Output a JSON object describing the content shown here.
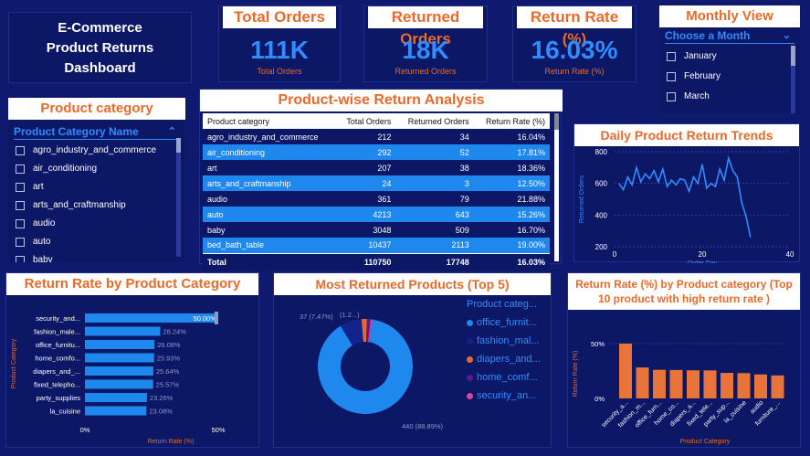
{
  "title": {
    "line1": "E-Commerce",
    "line2": "Product Returns",
    "line3": "Dashboard"
  },
  "kpis": [
    {
      "header": "Total Orders",
      "value": "111K",
      "label": "Total Orders"
    },
    {
      "header": "Returned Orders",
      "value": "18K",
      "label": "Returned Orders"
    },
    {
      "header": "Return Rate (%)",
      "value": "16.03%",
      "label": "Return Rate (%)"
    }
  ],
  "monthly_view": {
    "header": "Monthly View",
    "dropdown": "Choose a Month",
    "options": [
      "January",
      "February",
      "March"
    ]
  },
  "product_category_slicer": {
    "header": "Product category",
    "field": "Product Category Name",
    "options": [
      "agro_industry_and_commerce",
      "air_conditioning",
      "art",
      "arts_and_craftmanship",
      "audio",
      "auto",
      "baby"
    ]
  },
  "return_table": {
    "title": "Product-wise Return Analysis",
    "columns": [
      "Product category",
      "Total Orders",
      "Returned Orders",
      "Return Rate (%)"
    ],
    "rows": [
      [
        "agro_industry_and_commerce",
        "212",
        "34",
        "16.04%"
      ],
      [
        "air_conditioning",
        "292",
        "52",
        "17.81%"
      ],
      [
        "art",
        "207",
        "38",
        "18.36%"
      ],
      [
        "arts_and_craftmanship",
        "24",
        "3",
        "12.50%"
      ],
      [
        "audio",
        "361",
        "79",
        "21.88%"
      ],
      [
        "auto",
        "4213",
        "643",
        "15.26%"
      ],
      [
        "baby",
        "3048",
        "509",
        "16.70%"
      ],
      [
        "bed_bath_table",
        "10437",
        "2113",
        "19.00%"
      ]
    ],
    "total": [
      "Total",
      "110750",
      "17748",
      "16.03%"
    ]
  },
  "colors": {
    "background": "#0f1a6e",
    "tile": "#0c1766",
    "accent_blue": "#2f8dff",
    "accent_orange": "#e86a2a",
    "row_highlight": "#1e88ee"
  },
  "chart_data": [
    {
      "type": "line",
      "title": "Daily Product Return Trends",
      "xlabel": "Order Day",
      "ylabel": "Returned Orders",
      "xlim": [
        0,
        40
      ],
      "ylim": [
        200,
        800
      ],
      "xticks": [
        "0",
        "20",
        "40"
      ],
      "yticks": [
        "200",
        "400",
        "600",
        "800"
      ],
      "x": [
        1,
        2,
        3,
        4,
        5,
        6,
        7,
        8,
        9,
        10,
        11,
        12,
        13,
        14,
        15,
        16,
        17,
        18,
        19,
        20,
        21,
        22,
        23,
        24,
        25,
        26,
        27,
        28,
        29,
        30,
        31
      ],
      "y": [
        600,
        560,
        640,
        590,
        700,
        610,
        660,
        630,
        680,
        610,
        690,
        580,
        620,
        590,
        630,
        620,
        550,
        640,
        600,
        720,
        570,
        600,
        580,
        690,
        620,
        760,
        680,
        640,
        480,
        390,
        260
      ]
    },
    {
      "type": "bar",
      "orientation": "horizontal",
      "title": "Return Rate by Product Category",
      "xlabel": "Return Rate (%)",
      "ylabel": "Product Category",
      "xticks": [
        "0%",
        "50%"
      ],
      "xlim": [
        0,
        50
      ],
      "categories": [
        "security_and...",
        "fashion_male...",
        "office_furnitu...",
        "home_comfo...",
        "diapers_and_...",
        "fixed_telepho...",
        "party_supplies",
        "la_cuisine"
      ],
      "values": [
        50.0,
        28.24,
        26.08,
        25.93,
        25.64,
        25.57,
        23.26,
        23.08
      ],
      "data_labels": [
        "50.00%",
        "28.24%",
        "26.08%",
        "25.93%",
        "25.64%",
        "25.57%",
        "23.26%",
        "23.08%"
      ]
    },
    {
      "type": "pie",
      "title": "Most Returned Products (Top 5)",
      "legend_title": "Product categ...",
      "categories": [
        "office_furnit...",
        "fashion_mal...",
        "diapers_and...",
        "home_comf...",
        "security_an..."
      ],
      "values": [
        440,
        37,
        9,
        6,
        3
      ],
      "colors": [
        "#1e88ee",
        "#12238c",
        "#e86a2a",
        "#5a1a8c",
        "#e0449a"
      ],
      "data_labels": [
        "440 (88.89%)",
        "37 (7.47%)",
        "(1.2...)"
      ]
    },
    {
      "type": "bar",
      "title": "Return Rate (%) by Product category (Top 10 product with high return rate )",
      "xlabel": "Product Category",
      "ylabel": "Return Rate (%)",
      "yticks": [
        "0%",
        "50%"
      ],
      "ylim": [
        0,
        50
      ],
      "categories": [
        "security_a...",
        "fashion_m...",
        "office_furn...",
        "home_co...",
        "diapers_a...",
        "fixed_tele...",
        "party_sup...",
        "la_cuisine",
        "audio",
        "furniture_..."
      ],
      "values": [
        50.0,
        28.24,
        26.08,
        25.93,
        25.64,
        25.57,
        23.26,
        23.08,
        21.88,
        21.0
      ]
    }
  ]
}
